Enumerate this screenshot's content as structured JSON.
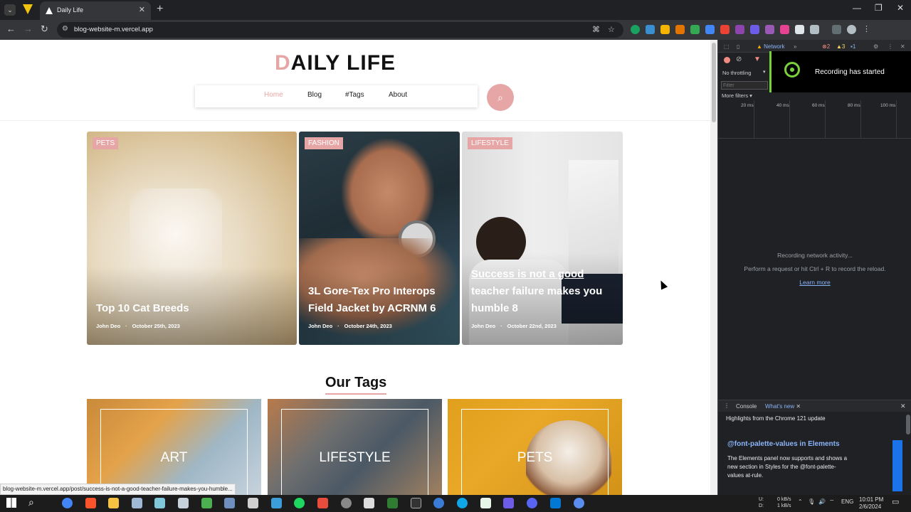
{
  "browser": {
    "tab_title": "Daily Life",
    "url": "blog-website-m.vercel.app",
    "status_url": "blog-website-m.vercel.app/post/success-is-not-a-good-teacher-failure-makes-you-humble..."
  },
  "site": {
    "logo_first": "D",
    "logo_rest": "AILY LIFE",
    "nav": [
      "Home",
      "Blog",
      "#Tags",
      "About"
    ],
    "posts": [
      {
        "category": "PETS",
        "title_lines": [
          "Top 10 Cat Breeds"
        ],
        "author": "John Deo",
        "date": "October 25th, 2023"
      },
      {
        "category": "FASHION",
        "title_lines": [
          "3L Gore-Tex Pro Interops",
          "Field Jacket by ACRNM 6"
        ],
        "author": "John Deo",
        "date": "October 24th, 2023"
      },
      {
        "category": "LIFESTYLE",
        "title_lines": [
          "Success is not a good",
          "teacher failure makes you",
          "humble 8"
        ],
        "author": "John Deo",
        "date": "October 22nd, 2023"
      }
    ],
    "tags_heading": "Our Tags",
    "tags": [
      "ART",
      "LIFESTYLE",
      "PETS"
    ]
  },
  "devtools": {
    "network_tab": "Network",
    "throttle": "No throttling",
    "filter_placeholder": "Filter",
    "more_filters": "More filters",
    "toast": "Recording has started",
    "timeline_ticks": [
      "20 ms",
      "40 ms",
      "60 ms",
      "80 ms",
      "100 ms"
    ],
    "empty_line1": "Recording network activity...",
    "empty_line2": "Perform a request or hit Ctrl + R to record the reload.",
    "learn_more": "Learn more",
    "drawer_tabs": [
      "Console",
      "What's new"
    ],
    "highlights": "Highlights from the Chrome 121 update",
    "feature_title": "@font-palette-values in Elements",
    "feature_desc_lines": [
      "The Elements panel now supports and shows a",
      "new section in Styles for the @font-palette-",
      "values at-rule."
    ]
  },
  "taskbar": {
    "net_up": "0 kB/s",
    "net_down": "1 kB/s",
    "net_up_label": "U:",
    "net_down_label": "D:",
    "lang": "ENG",
    "time": "10:01 PM",
    "date": "2/6/2024"
  },
  "colors": {
    "accent": "#e6a6a6",
    "toast_green": "#7bcf3a"
  }
}
